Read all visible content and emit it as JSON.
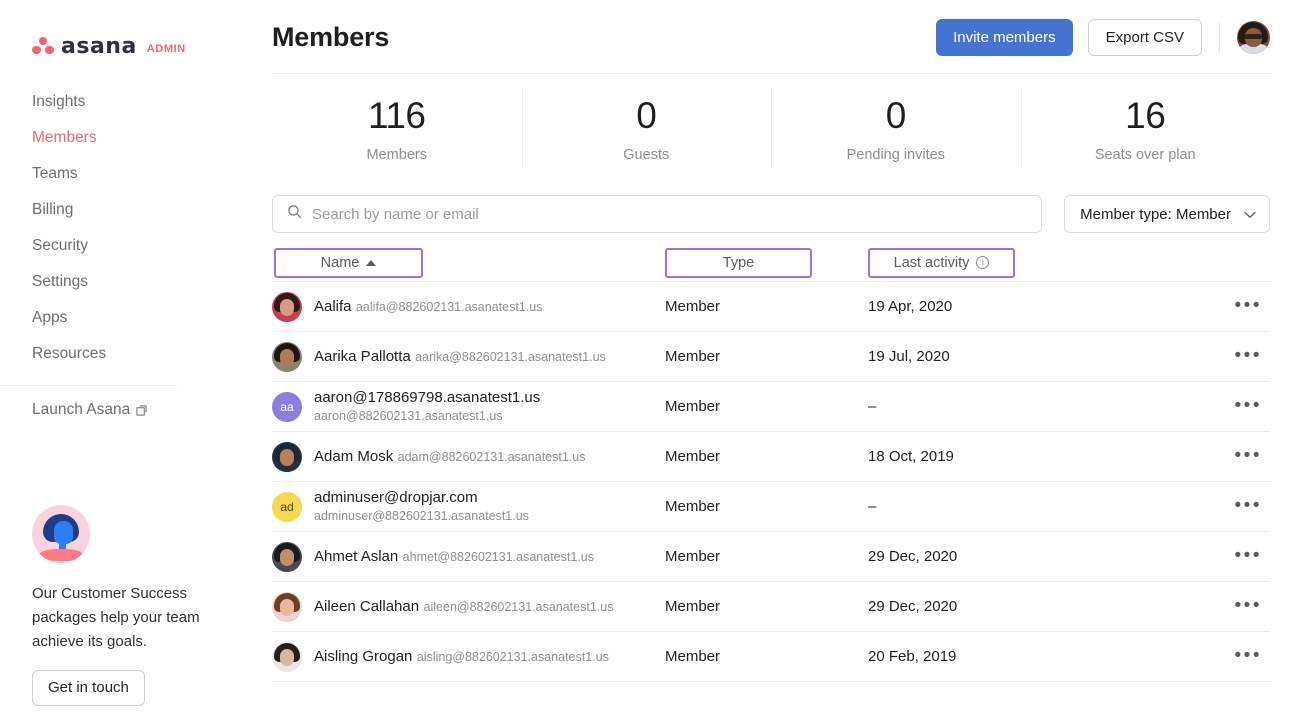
{
  "brand": {
    "wordmark": "asana",
    "suffix": "ADMIN",
    "dot_color": "#fc636b",
    "wordmark_color": "#2e2f45",
    "suffix_color": "#f06a6a"
  },
  "sidebar": {
    "items": [
      {
        "label": "Insights",
        "active": false
      },
      {
        "label": "Members",
        "active": true
      },
      {
        "label": "Teams",
        "active": false
      },
      {
        "label": "Billing",
        "active": false
      },
      {
        "label": "Security",
        "active": false
      },
      {
        "label": "Settings",
        "active": false
      },
      {
        "label": "Apps",
        "active": false
      },
      {
        "label": "Resources",
        "active": false
      }
    ],
    "launch": {
      "label": "Launch Asana",
      "icon": "external-link-icon"
    },
    "promo": {
      "text": "Our Customer Success packages help your team achieve its goals.",
      "button_label": "Get in touch"
    }
  },
  "header": {
    "title": "Members",
    "invite_label": "Invite members",
    "export_label": "Export CSV",
    "primary_color": "#4573d2",
    "avatar_name": "avatar"
  },
  "stats": [
    {
      "value": "116",
      "label": "Members"
    },
    {
      "value": "0",
      "label": "Guests"
    },
    {
      "value": "0",
      "label": "Pending invites"
    },
    {
      "value": "16",
      "label": "Seats over plan"
    }
  ],
  "search": {
    "placeholder": "Search by name or email",
    "value": "",
    "icon": "search-icon"
  },
  "member_type_filter": {
    "label": "Member type: Member",
    "icon": "chevron-down-icon"
  },
  "table": {
    "highlight_color": "#9d6ff0",
    "headers": {
      "name": "Name",
      "name_sort": "ascending",
      "type": "Type",
      "last_activity": "Last activity",
      "last_activity_icon": "info-icon"
    },
    "rows": [
      {
        "name": "Aalifa",
        "email": "aalifa@882602131.asanatest1.us",
        "type": "Member",
        "last_activity": "19 Apr, 2020",
        "avatar": {
          "kind": "photo",
          "hair": "#2a1d18",
          "face": "#d79a82",
          "body": "#c6404f"
        }
      },
      {
        "name": "Aarika Pallotta",
        "email": "aarika@882602131.asanatest1.us",
        "type": "Member",
        "last_activity": "19 Jul, 2020",
        "avatar": {
          "kind": "photo",
          "hair": "#201713",
          "face": "#b07a58",
          "body": "#8e8471"
        }
      },
      {
        "name": "aaron@178869798.asanatest1.us",
        "email": "aaron@882602131.asanatest1.us",
        "type": "Member",
        "last_activity": "–",
        "avatar": {
          "kind": "initials",
          "initials": "aa",
          "bg": "#8a7ee0",
          "fg": "#ffffff"
        }
      },
      {
        "name": "Adam Mosk",
        "email": "adam@882602131.asanatest1.us",
        "type": "Member",
        "last_activity": "18 Oct, 2019",
        "avatar": {
          "kind": "photo",
          "hair": "#1c2733",
          "face": "#b9805c",
          "body": "#23313f"
        }
      },
      {
        "name": "adminuser@dropjar.com",
        "email": "adminuser@882602131.asanatest1.us",
        "type": "Member",
        "last_activity": "–",
        "avatar": {
          "kind": "initials",
          "initials": "ad",
          "bg": "#f5d94e",
          "fg": "#4a3c12"
        }
      },
      {
        "name": "Ahmet Aslan",
        "email": "ahmet@882602131.asanatest1.us",
        "type": "Member",
        "last_activity": "29 Dec, 2020",
        "avatar": {
          "kind": "photo",
          "hair": "#1a1a1f",
          "face": "#c08f68",
          "body": "#4b4758"
        }
      },
      {
        "name": "Aileen Callahan",
        "email": "aileen@882602131.asanatest1.us",
        "type": "Member",
        "last_activity": "29 Dec, 2020",
        "avatar": {
          "kind": "photo",
          "hair": "#6b4026",
          "face": "#e9b89b",
          "body": "#f2d3d3"
        }
      },
      {
        "name": "Aisling Grogan",
        "email": "aisling@882602131.asanatest1.us",
        "type": "Member",
        "last_activity": "20 Feb, 2019",
        "avatar": {
          "kind": "photo",
          "hair": "#23201c",
          "face": "#d8b79d",
          "body": "#e8e8e8"
        }
      }
    ],
    "row_menu_label": "•••"
  }
}
